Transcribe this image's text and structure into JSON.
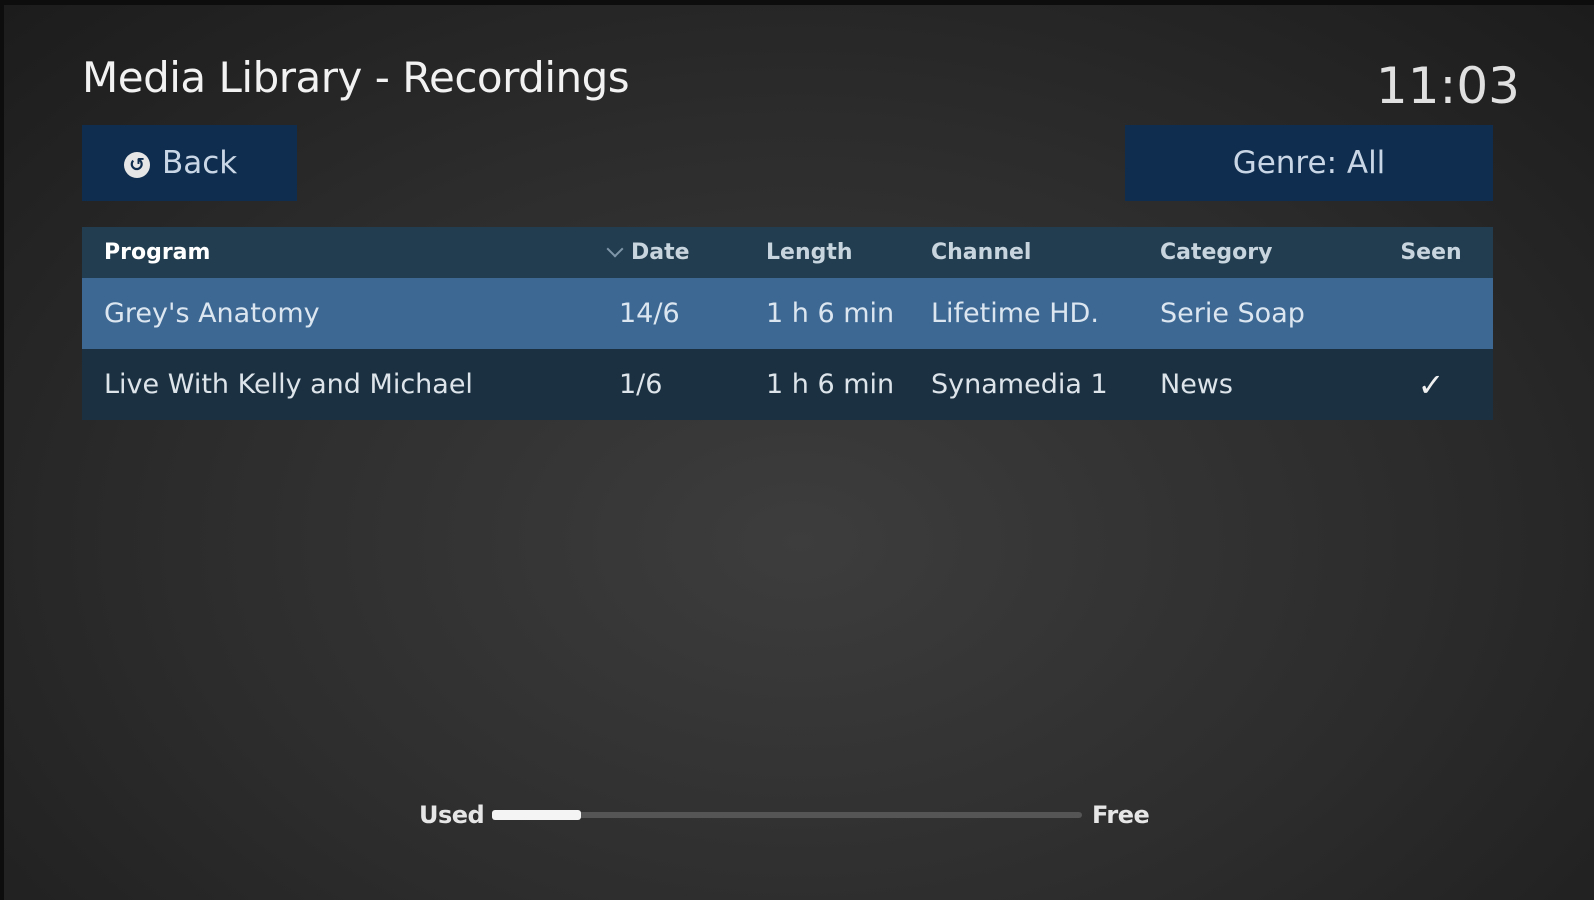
{
  "header": {
    "title": "Media Library - Recordings",
    "clock": "11:03"
  },
  "toolbar": {
    "back_label": "Back",
    "back_icon": "back-arrow-icon",
    "genre_label": "Genre: All"
  },
  "table": {
    "columns": {
      "program": "Program",
      "date": "Date",
      "length": "Length",
      "channel": "Channel",
      "category": "Category",
      "seen": "Seen"
    },
    "sort_icon": "chevron-down-icon",
    "rows": [
      {
        "program": "Grey's Anatomy",
        "date": "14/6",
        "length": "1 h 6 min",
        "channel": "Lifetime HD.",
        "category": "Serie Soap",
        "seen": ""
      },
      {
        "program": "Live With Kelly and Michael",
        "date": "1/6",
        "length": "1 h 6 min",
        "channel": "Synamedia 1",
        "category": "News",
        "seen": "✓"
      }
    ]
  },
  "storage": {
    "used_label": "Used",
    "free_label": "Free",
    "used_fraction": 0.15
  },
  "colors": {
    "button_bg": "#0f2d4e",
    "header_row_bg": "#213d4f",
    "selected_row_bg": "#3d6894",
    "row_bg": "#1b3142"
  }
}
